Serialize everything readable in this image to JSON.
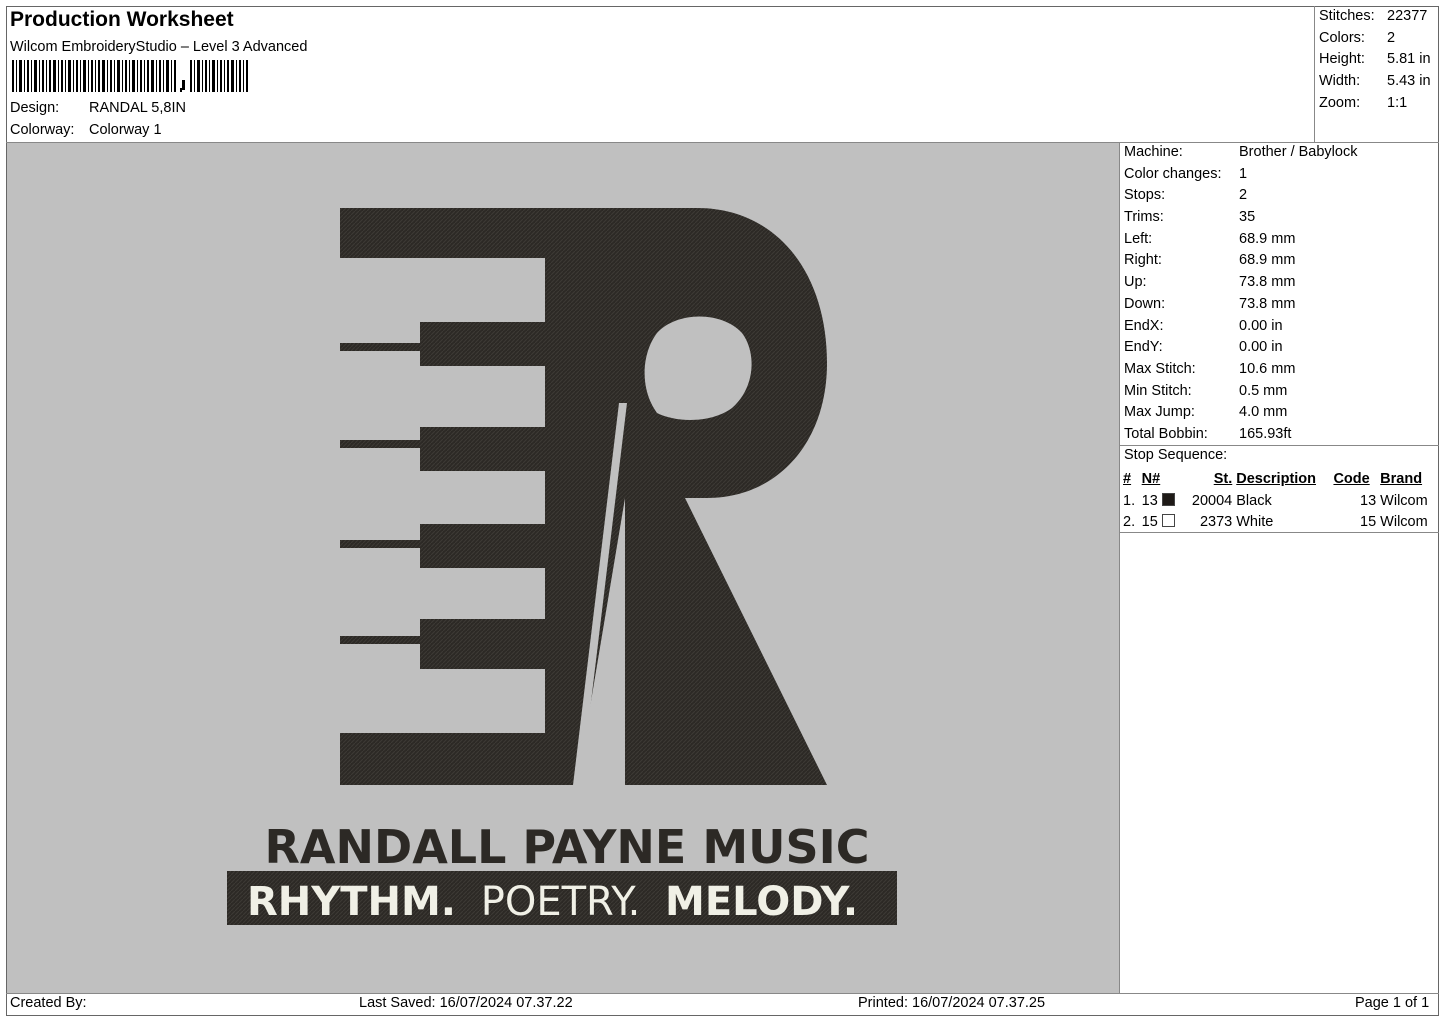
{
  "header": {
    "title": "Production Worksheet",
    "software": "Wilcom EmbroideryStudio – Level 3 Advanced",
    "design_label": "Design:",
    "design_value": "RANDAL 5,8IN",
    "colorway_label": "Colorway:",
    "colorway_value": "Colorway 1"
  },
  "summary": [
    {
      "label": "Stitches:",
      "value": "22377"
    },
    {
      "label": "Colors:",
      "value": "2"
    },
    {
      "label": "Height:",
      "value": "5.81 in"
    },
    {
      "label": "Width:",
      "value": "5.43 in"
    },
    {
      "label": "Zoom:",
      "value": "1:1"
    }
  ],
  "details": [
    {
      "label": "Machine:",
      "value": "Brother / Babylock"
    },
    {
      "label": "Color changes:",
      "value": "1"
    },
    {
      "label": "Stops:",
      "value": "2"
    },
    {
      "label": "Trims:",
      "value": "35"
    },
    {
      "label": "Left:",
      "value": "68.9 mm"
    },
    {
      "label": "Right:",
      "value": "68.9 mm"
    },
    {
      "label": "Up:",
      "value": "73.8 mm"
    },
    {
      "label": "Down:",
      "value": "73.8 mm"
    },
    {
      "label": "EndX:",
      "value": "0.00 in"
    },
    {
      "label": "EndY:",
      "value": "0.00 in"
    },
    {
      "label": "Max Stitch:",
      "value": "10.6 mm"
    },
    {
      "label": "Min Stitch:",
      "value": "0.5 mm"
    },
    {
      "label": "Max Jump:",
      "value": "4.0 mm"
    },
    {
      "label": "Total Bobbin:",
      "value": "165.93ft"
    }
  ],
  "stop_sequence": {
    "title": "Stop Sequence:",
    "columns": [
      "#",
      "N#",
      "St.",
      "Description",
      "Code",
      "Brand"
    ],
    "rows": [
      {
        "idx": "1.",
        "n": "13",
        "color": "#1e1a17",
        "st": "20004",
        "desc": "Black",
        "code": "13",
        "brand": "Wilcom"
      },
      {
        "idx": "2.",
        "n": "15",
        "color": "#ffffff",
        "st": "2373",
        "desc": "White",
        "code": "15",
        "brand": "Wilcom"
      }
    ]
  },
  "design_text": {
    "line1": "RANDALL PAYNE MUSIC",
    "line2_a": "RHYTHM.",
    "line2_b": "POETRY.",
    "line2_c": "MELODY."
  },
  "footer": {
    "created_by": "Created By:",
    "last_saved": "Last Saved: 16/07/2024 07.37.22",
    "printed": "Printed: 16/07/2024 07.37.25",
    "page": "Page 1 of 1"
  },
  "colors": {
    "preview_bg": "#c0c0c0",
    "thread_dark": "#2c2925",
    "thread_light": "#f0f0e6"
  }
}
